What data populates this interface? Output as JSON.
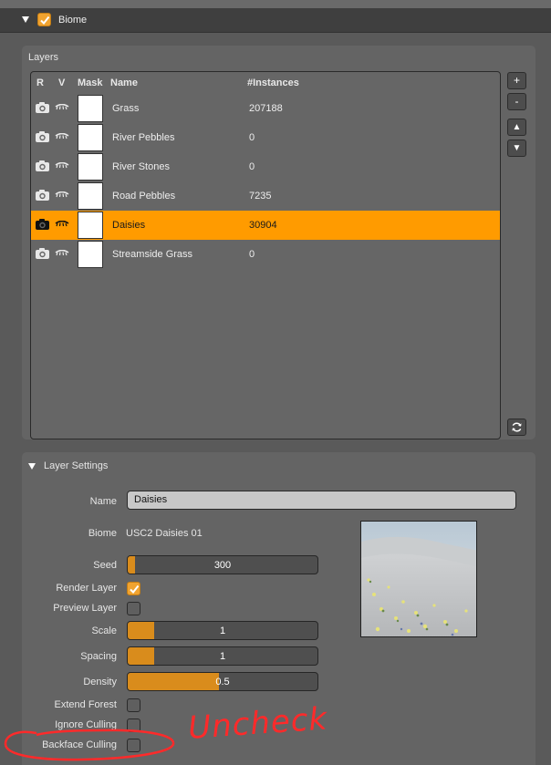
{
  "header": {
    "title": "Biome",
    "checked": true
  },
  "layers_panel": {
    "title": "Layers",
    "columns": {
      "r": "R",
      "v": "V",
      "mask": "Mask",
      "name": "Name",
      "instances": "#Instances"
    },
    "rows": [
      {
        "name": "Grass",
        "instances": "207188",
        "selected": false
      },
      {
        "name": "River Pebbles",
        "instances": "0",
        "selected": false
      },
      {
        "name": "River Stones",
        "instances": "0",
        "selected": false
      },
      {
        "name": "Road Pebbles",
        "instances": "7235",
        "selected": false
      },
      {
        "name": "Daisies",
        "instances": "30904",
        "selected": true
      },
      {
        "name": "Streamside Grass",
        "instances": "0",
        "selected": false
      }
    ],
    "buttons": {
      "add": "+",
      "remove": "-",
      "up": "▲",
      "down": "▼"
    }
  },
  "settings_panel": {
    "title": "Layer Settings",
    "name_label": "Name",
    "name_value": "Daisies",
    "biome_label": "Biome",
    "biome_value": "USC2 Daisies 01",
    "seed_label": "Seed",
    "seed_value": "300",
    "seed_fill": 0.04,
    "render_layer_label": "Render Layer",
    "render_layer_checked": true,
    "preview_layer_label": "Preview Layer",
    "preview_layer_checked": false,
    "scale_label": "Scale",
    "scale_value": "1",
    "scale_fill": 0.14,
    "spacing_label": "Spacing",
    "spacing_value": "1",
    "spacing_fill": 0.14,
    "density_label": "Density",
    "density_value": "0.5",
    "density_fill": 0.48,
    "extend_forest_label": "Extend Forest",
    "extend_forest_checked": false,
    "ignore_culling_label": "Ignore Culling",
    "ignore_culling_checked": false,
    "backface_culling_label": "Backface Culling",
    "backface_culling_checked": false
  },
  "annotation": {
    "text": "Uncheck",
    "color": "#ff2a2a"
  },
  "colors": {
    "accent": "#ff9b00",
    "check": "#f0a330",
    "slider_fill": "#d98c1c"
  },
  "icons": {
    "camera": "camera-icon",
    "eye": "eye-lashes-icon",
    "refresh": "refresh-icon"
  }
}
